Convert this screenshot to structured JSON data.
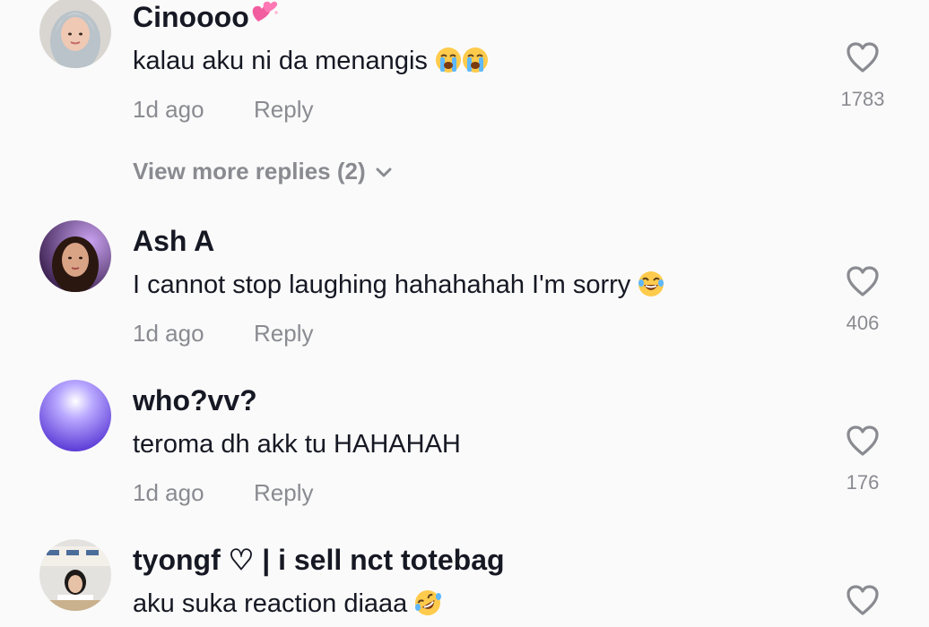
{
  "comments": [
    {
      "username": "Cinoooo",
      "username_emoji": "heart-sparkle-emoji",
      "text": "kalau aku ni da menangis",
      "text_emojis": [
        "loudly-crying-face-emoji",
        "loudly-crying-face-emoji"
      ],
      "time": "1d ago",
      "reply_label": "Reply",
      "likes": "1783",
      "view_more": "View more replies (2)"
    },
    {
      "username": "Ash A",
      "text": "I cannot stop laughing hahahahah I'm sorry",
      "text_emojis": [
        "face-with-tears-of-joy-emoji"
      ],
      "time": "1d ago",
      "reply_label": "Reply",
      "likes": "406"
    },
    {
      "username": "who?vv?",
      "text": "teroma dh akk tu HAHAHAH",
      "time": "1d ago",
      "reply_label": "Reply",
      "likes": "176"
    },
    {
      "username": "tyongf ♡ | i sell nct totebag",
      "text": "aku suka reaction diaaa",
      "text_emojis": [
        "rolling-on-floor-laughing-emoji"
      ]
    }
  ],
  "colors": {
    "background": "#fafafa",
    "primary_text": "#161823",
    "secondary_text": "#8a8b91",
    "heart_outline": "#8a8b91"
  }
}
